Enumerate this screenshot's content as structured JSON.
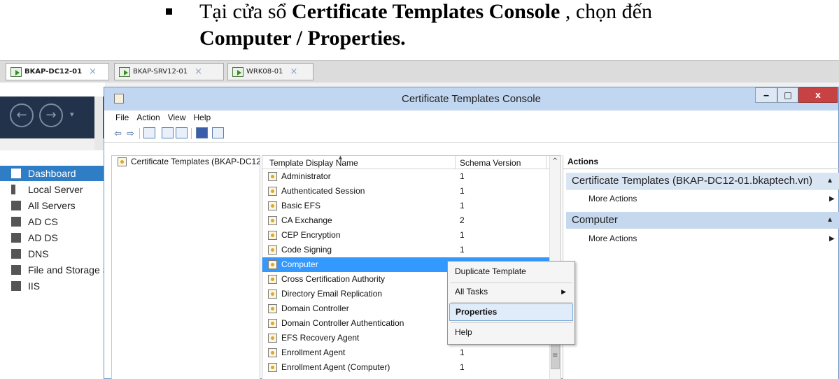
{
  "caption": {
    "line1_prefix": "Tại cửa sổ ",
    "line1_bold": "Certificate Templates Console",
    "line1_suffix": " , chọn đến",
    "line2": "Computer / Properties."
  },
  "vm_tabs": [
    {
      "label": "BKAP-DC12-01",
      "close": "×",
      "active": true
    },
    {
      "label": "BKAP-SRV12-01",
      "close": "×",
      "active": false
    },
    {
      "label": "WRK08-01",
      "close": "×",
      "active": false
    }
  ],
  "server_manager": {
    "nav_items": [
      {
        "label": "Dashboard",
        "icon": "dashboard-icon",
        "selected": true
      },
      {
        "label": "Local Server",
        "icon": "server-icon",
        "selected": false
      },
      {
        "label": "All Servers",
        "icon": "servers-icon",
        "selected": false
      },
      {
        "label": "AD CS",
        "icon": "adcs-icon",
        "selected": false
      },
      {
        "label": "AD DS",
        "icon": "adds-icon",
        "selected": false
      },
      {
        "label": "DNS",
        "icon": "dns-icon",
        "selected": false
      },
      {
        "label": "File and Storage Services",
        "icon": "file-storage-icon",
        "selected": false
      },
      {
        "label": "IIS",
        "icon": "iis-icon",
        "selected": false
      }
    ]
  },
  "console": {
    "title": "Certificate Templates Console",
    "window_buttons": {
      "minimize": "‒",
      "maximize": "□",
      "close": "x"
    },
    "menu": [
      "File",
      "Action",
      "View",
      "Help"
    ],
    "tree_root": "Certificate Templates (BKAP-DC12-01.bkaptech.vn)",
    "columns": {
      "name": "Template Display Name",
      "schema": "Schema Version"
    },
    "templates": [
      {
        "name": "Administrator",
        "schema": "1"
      },
      {
        "name": "Authenticated Session",
        "schema": "1"
      },
      {
        "name": "Basic EFS",
        "schema": "1"
      },
      {
        "name": "CA Exchange",
        "schema": "2"
      },
      {
        "name": "CEP Encryption",
        "schema": "1"
      },
      {
        "name": "Code Signing",
        "schema": "1"
      },
      {
        "name": "Computer",
        "schema": "1",
        "selected": true
      },
      {
        "name": "Cross Certification Authority",
        "schema": ""
      },
      {
        "name": "Directory Email Replication",
        "schema": ""
      },
      {
        "name": "Domain Controller",
        "schema": ""
      },
      {
        "name": "Domain Controller Authentication",
        "schema": ""
      },
      {
        "name": "EFS Recovery Agent",
        "schema": ""
      },
      {
        "name": "Enrollment Agent",
        "schema": "1"
      },
      {
        "name": "Enrollment Agent (Computer)",
        "schema": "1"
      }
    ],
    "actions": {
      "header": "Actions",
      "sections": [
        {
          "title": "Certificate Templates (BKAP-DC12-01.bkaptech.vn)",
          "link": "More Actions"
        },
        {
          "title": "Computer",
          "link": "More Actions"
        }
      ]
    },
    "context_menu": [
      {
        "label": "Duplicate Template",
        "highlighted": false,
        "submenu": false
      },
      {
        "label": "All Tasks",
        "highlighted": false,
        "submenu": true
      },
      {
        "label": "Properties",
        "highlighted": true,
        "submenu": false
      },
      {
        "label": "Help",
        "highlighted": false,
        "submenu": false
      }
    ]
  },
  "colors": {
    "selection": "#3399ff",
    "nav_selected": "#2f7dc4",
    "title_bar": "#c1d6f0",
    "close_button": "#c74343"
  }
}
